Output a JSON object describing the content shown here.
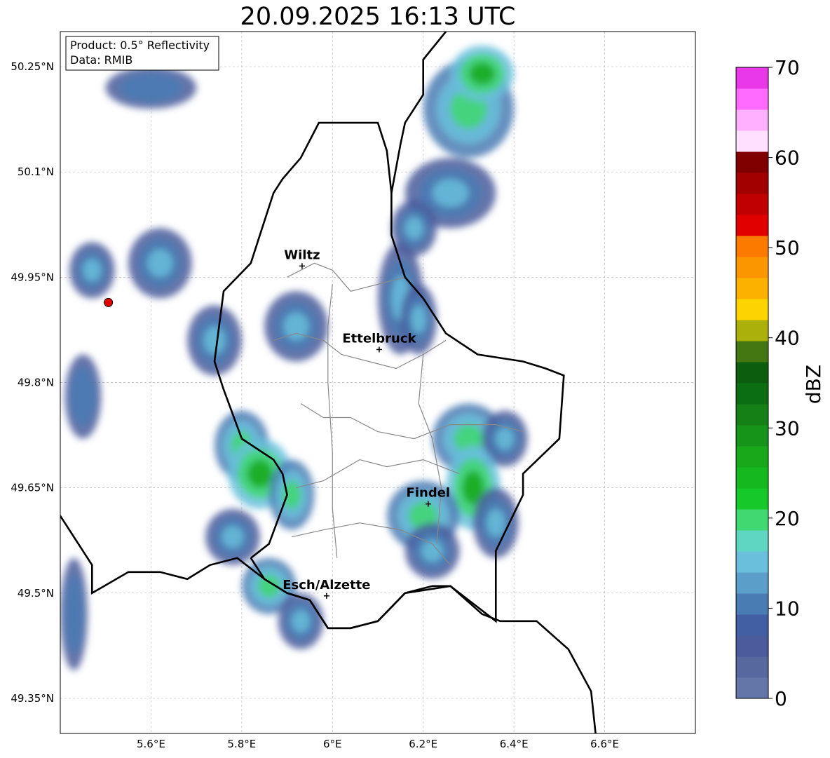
{
  "title": "20.09.2025 16:13 UTC",
  "info_box": {
    "product": "Product: 0.5° Reflectivity",
    "data_source": "Data: RMIB"
  },
  "map": {
    "lon_range": [
      5.4,
      6.8
    ],
    "lat_range": [
      49.3,
      50.3
    ],
    "x_ticks": [
      {
        "value": 5.6,
        "label": "5.6°E"
      },
      {
        "value": 5.8,
        "label": "5.8°E"
      },
      {
        "value": 6.0,
        "label": "6°E"
      },
      {
        "value": 6.2,
        "label": "6.2°E"
      },
      {
        "value": 6.4,
        "label": "6.4°E"
      },
      {
        "value": 6.6,
        "label": "6.6°E"
      }
    ],
    "y_ticks": [
      {
        "value": 50.25,
        "label": "50.25°N"
      },
      {
        "value": 50.1,
        "label": "50.1°N"
      },
      {
        "value": 49.95,
        "label": "49.95°N"
      },
      {
        "value": 49.8,
        "label": "49.8°N"
      },
      {
        "value": 49.65,
        "label": "49.65°N"
      },
      {
        "value": 49.5,
        "label": "49.5°N"
      },
      {
        "value": 49.35,
        "label": "49.35°N"
      }
    ],
    "grid": true,
    "radar_site": {
      "lon": 5.506,
      "lat": 49.914
    },
    "cities": [
      {
        "name": "Wiltz",
        "lon": 5.933,
        "lat": 49.966
      },
      {
        "name": "Ettelbruck",
        "lon": 6.103,
        "lat": 49.847
      },
      {
        "name": "Findel",
        "lon": 6.211,
        "lat": 49.627
      },
      {
        "name": "Esch/Alzette",
        "lon": 5.987,
        "lat": 49.496
      }
    ],
    "country_border": [
      [
        5.4,
        49.61
      ],
      [
        5.47,
        49.54
      ],
      [
        5.47,
        49.5
      ],
      [
        5.55,
        49.53
      ],
      [
        5.62,
        49.53
      ],
      [
        5.68,
        49.52
      ],
      [
        5.73,
        49.54
      ],
      [
        5.79,
        49.55
      ],
      [
        5.85,
        49.52
      ],
      [
        5.9,
        49.5
      ],
      [
        5.95,
        49.49
      ],
      [
        5.99,
        49.45
      ],
      [
        6.04,
        49.45
      ],
      [
        6.1,
        49.46
      ],
      [
        6.16,
        49.5
      ],
      [
        6.26,
        49.51
      ],
      [
        6.33,
        49.47
      ],
      [
        6.37,
        49.46
      ],
      [
        6.45,
        49.46
      ],
      [
        6.52,
        49.42
      ],
      [
        6.57,
        49.36
      ],
      [
        6.58,
        49.3
      ]
    ],
    "lux_border": [
      [
        5.82,
        49.55
      ],
      [
        5.85,
        49.52
      ],
      [
        5.9,
        49.5
      ],
      [
        5.95,
        49.49
      ],
      [
        5.99,
        49.45
      ],
      [
        6.04,
        49.45
      ],
      [
        6.1,
        49.46
      ],
      [
        6.16,
        49.5
      ],
      [
        6.22,
        49.51
      ],
      [
        6.26,
        49.51
      ],
      [
        6.36,
        49.46
      ],
      [
        6.36,
        49.56
      ],
      [
        6.42,
        49.64
      ],
      [
        6.42,
        49.67
      ],
      [
        6.5,
        49.72
      ],
      [
        6.51,
        49.81
      ],
      [
        6.47,
        49.82
      ],
      [
        6.42,
        49.83
      ],
      [
        6.32,
        49.84
      ],
      [
        6.25,
        49.87
      ],
      [
        6.2,
        49.92
      ],
      [
        6.16,
        49.95
      ],
      [
        6.13,
        50.01
      ],
      [
        6.13,
        50.07
      ],
      [
        6.12,
        50.13
      ],
      [
        6.1,
        50.17
      ],
      [
        6.02,
        50.17
      ],
      [
        5.97,
        50.17
      ],
      [
        5.93,
        50.12
      ],
      [
        5.89,
        50.09
      ],
      [
        5.87,
        50.07
      ],
      [
        5.84,
        50.01
      ],
      [
        5.82,
        49.97
      ],
      [
        5.76,
        49.93
      ],
      [
        5.75,
        49.88
      ],
      [
        5.74,
        49.83
      ],
      [
        5.76,
        49.79
      ],
      [
        5.8,
        49.72
      ],
      [
        5.87,
        49.69
      ],
      [
        5.89,
        49.67
      ],
      [
        5.9,
        49.64
      ],
      [
        5.86,
        49.57
      ],
      [
        5.82,
        49.55
      ]
    ],
    "de_border": [
      [
        6.13,
        50.07
      ],
      [
        6.15,
        50.14
      ],
      [
        6.16,
        50.17
      ],
      [
        6.2,
        50.21
      ],
      [
        6.2,
        50.26
      ],
      [
        6.25,
        50.3
      ]
    ],
    "canton_lines": [
      [
        [
          5.9,
          49.95
        ],
        [
          5.96,
          49.97
        ],
        [
          6.0,
          49.96
        ],
        [
          6.04,
          49.93
        ],
        [
          6.1,
          49.94
        ],
        [
          6.16,
          49.95
        ]
      ],
      [
        [
          5.87,
          49.86
        ],
        [
          5.92,
          49.87
        ],
        [
          5.98,
          49.86
        ],
        [
          6.02,
          49.84
        ],
        [
          6.08,
          49.83
        ],
        [
          6.14,
          49.82
        ],
        [
          6.2,
          49.84
        ],
        [
          6.25,
          49.86
        ]
      ],
      [
        [
          5.93,
          49.77
        ],
        [
          5.98,
          49.75
        ],
        [
          6.04,
          49.75
        ],
        [
          6.1,
          49.73
        ],
        [
          6.18,
          49.72
        ],
        [
          6.26,
          49.74
        ],
        [
          6.36,
          49.74
        ],
        [
          6.42,
          49.73
        ]
      ],
      [
        [
          5.92,
          49.65
        ],
        [
          5.98,
          49.66
        ],
        [
          6.06,
          49.69
        ],
        [
          6.12,
          49.68
        ],
        [
          6.2,
          49.69
        ],
        [
          6.28,
          49.67
        ]
      ],
      [
        [
          5.91,
          49.58
        ],
        [
          5.98,
          49.59
        ],
        [
          6.06,
          49.6
        ],
        [
          6.15,
          49.59
        ],
        [
          6.22,
          49.57
        ],
        [
          6.26,
          49.54
        ]
      ],
      [
        [
          6.0,
          49.94
        ],
        [
          5.99,
          49.88
        ],
        [
          5.99,
          49.8
        ],
        [
          6.0,
          49.7
        ],
        [
          6.0,
          49.62
        ],
        [
          6.01,
          49.55
        ]
      ],
      [
        [
          6.2,
          49.84
        ],
        [
          6.19,
          49.77
        ],
        [
          6.22,
          49.72
        ],
        [
          6.24,
          49.65
        ],
        [
          6.23,
          49.57
        ]
      ]
    ]
  },
  "radar_cells": [
    {
      "lon": 5.47,
      "lat": 49.96,
      "rx": 0.05,
      "ry": 0.04,
      "level": 2
    },
    {
      "lon": 5.62,
      "lat": 49.97,
      "rx": 0.07,
      "ry": 0.05,
      "level": 2
    },
    {
      "lon": 5.74,
      "lat": 49.86,
      "rx": 0.06,
      "ry": 0.05,
      "level": 2
    },
    {
      "lon": 5.6,
      "lat": 50.22,
      "rx": 0.1,
      "ry": 0.03,
      "level": 1
    },
    {
      "lon": 5.92,
      "lat": 49.88,
      "rx": 0.07,
      "ry": 0.05,
      "level": 2
    },
    {
      "lon": 5.8,
      "lat": 49.71,
      "rx": 0.06,
      "ry": 0.05,
      "level": 3
    },
    {
      "lon": 5.84,
      "lat": 49.67,
      "rx": 0.07,
      "ry": 0.05,
      "level": 4
    },
    {
      "lon": 5.91,
      "lat": 49.64,
      "rx": 0.05,
      "ry": 0.05,
      "level": 3
    },
    {
      "lon": 5.78,
      "lat": 49.58,
      "rx": 0.06,
      "ry": 0.04,
      "level": 2
    },
    {
      "lon": 5.86,
      "lat": 49.51,
      "rx": 0.06,
      "ry": 0.04,
      "level": 3
    },
    {
      "lon": 5.93,
      "lat": 49.46,
      "rx": 0.05,
      "ry": 0.04,
      "level": 2
    },
    {
      "lon": 6.15,
      "lat": 49.92,
      "rx": 0.05,
      "ry": 0.08,
      "level": 2
    },
    {
      "lon": 6.19,
      "lat": 49.89,
      "rx": 0.04,
      "ry": 0.05,
      "level": 2
    },
    {
      "lon": 6.3,
      "lat": 50.19,
      "rx": 0.1,
      "ry": 0.07,
      "level": 3
    },
    {
      "lon": 6.33,
      "lat": 50.24,
      "rx": 0.07,
      "ry": 0.04,
      "level": 4
    },
    {
      "lon": 6.26,
      "lat": 50.07,
      "rx": 0.1,
      "ry": 0.05,
      "level": 2
    },
    {
      "lon": 6.18,
      "lat": 50.02,
      "rx": 0.05,
      "ry": 0.04,
      "level": 2
    },
    {
      "lon": 6.3,
      "lat": 49.72,
      "rx": 0.08,
      "ry": 0.05,
      "level": 3
    },
    {
      "lon": 6.38,
      "lat": 49.72,
      "rx": 0.05,
      "ry": 0.04,
      "level": 2
    },
    {
      "lon": 6.31,
      "lat": 49.65,
      "rx": 0.06,
      "ry": 0.06,
      "level": 4
    },
    {
      "lon": 6.2,
      "lat": 49.61,
      "rx": 0.08,
      "ry": 0.05,
      "level": 3
    },
    {
      "lon": 6.36,
      "lat": 49.6,
      "rx": 0.05,
      "ry": 0.05,
      "level": 2
    },
    {
      "lon": 6.22,
      "lat": 49.56,
      "rx": 0.06,
      "ry": 0.04,
      "level": 2
    },
    {
      "lon": 5.45,
      "lat": 49.78,
      "rx": 0.04,
      "ry": 0.06,
      "level": 1
    },
    {
      "lon": 5.43,
      "lat": 49.47,
      "rx": 0.03,
      "ry": 0.08,
      "level": 1
    }
  ],
  "colorbar": {
    "label": "dBZ",
    "min": 0,
    "max": 70,
    "ticks": [
      {
        "value": 0,
        "label": "0"
      },
      {
        "value": 10,
        "label": "10"
      },
      {
        "value": 20,
        "label": "20"
      },
      {
        "value": 30,
        "label": "30"
      },
      {
        "value": 40,
        "label": "40"
      },
      {
        "value": 50,
        "label": "50"
      },
      {
        "value": 60,
        "label": "60"
      },
      {
        "value": 70,
        "label": "70"
      }
    ],
    "colors": [
      "#6276a8",
      "#56699f",
      "#4a5c9b",
      "#435fa3",
      "#4a7cb4",
      "#5a9ec9",
      "#69bfdc",
      "#5ed6c2",
      "#40d870",
      "#16c82a",
      "#16b81f",
      "#18a81a",
      "#16941a",
      "#148016",
      "#0c6e12",
      "#0c5e0e",
      "#447711",
      "#abb10a",
      "#fdd300",
      "#fcb100",
      "#fb9600",
      "#fd7a00",
      "#e10000",
      "#c00000",
      "#a20000",
      "#800000",
      "#ffe1ff",
      "#ffb0ff",
      "#ff6aff",
      "#e838e8"
    ]
  }
}
